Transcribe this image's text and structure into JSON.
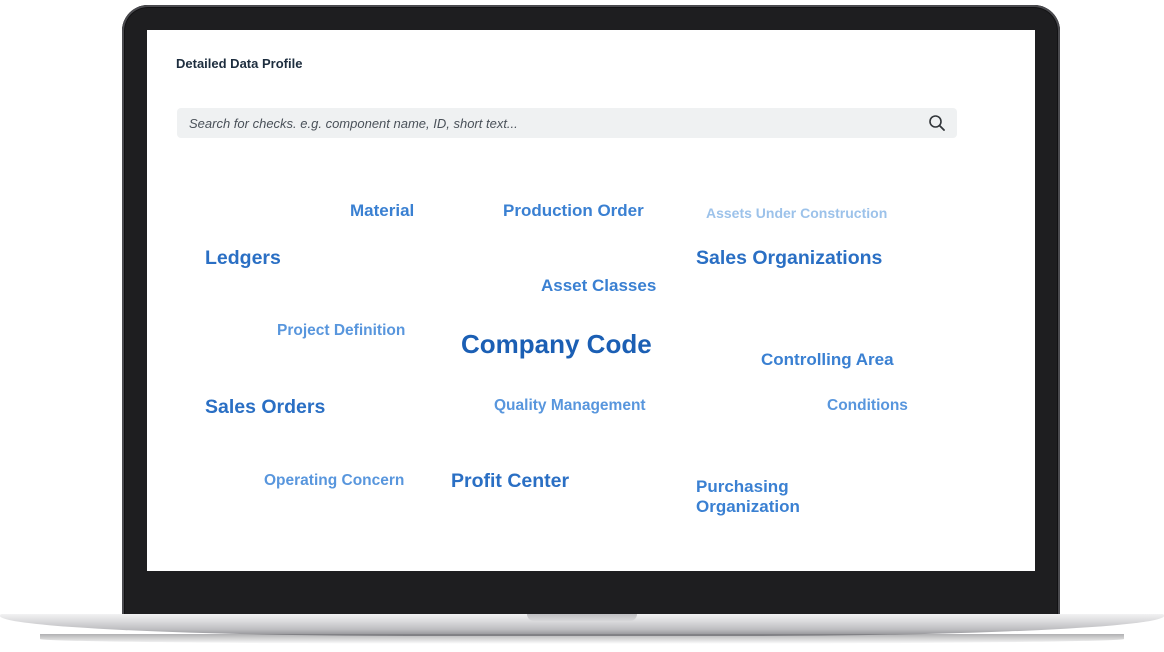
{
  "panel": {
    "title": "Detailed Data Profile"
  },
  "search": {
    "placeholder": "Search for checks. e.g. component name, ID, short text...",
    "value": "",
    "icon": "search-icon"
  },
  "tag_cloud": {
    "tags": [
      {
        "id": "material",
        "label": "Material"
      },
      {
        "id": "production-order",
        "label": "Production Order"
      },
      {
        "id": "assets-under-construction",
        "label": "Assets Under Construction"
      },
      {
        "id": "ledgers",
        "label": "Ledgers"
      },
      {
        "id": "sales-organizations",
        "label": "Sales Organizations"
      },
      {
        "id": "asset-classes",
        "label": "Asset Classes"
      },
      {
        "id": "project-definition",
        "label": "Project Definition"
      },
      {
        "id": "company-code",
        "label": "Company Code"
      },
      {
        "id": "controlling-area",
        "label": "Controlling Area"
      },
      {
        "id": "sales-orders",
        "label": "Sales Orders"
      },
      {
        "id": "quality-management",
        "label": "Quality Management"
      },
      {
        "id": "conditions",
        "label": "Conditions"
      },
      {
        "id": "operating-concern",
        "label": "Operating Concern"
      },
      {
        "id": "profit-center",
        "label": "Profit Center"
      },
      {
        "id": "purchasing-organization-line1",
        "label": "Purchasing"
      },
      {
        "id": "purchasing-organization-line2",
        "label": "Organization"
      }
    ]
  },
  "colors": {
    "bezel": "#1e1e20",
    "title": "#1d2d3e",
    "search_bg": "#eff1f2",
    "tag_lightest": "#9cc2ea",
    "tag_light": "#5896dd",
    "tag_medium": "#3a80d2",
    "tag_strong": "#2a6fc4",
    "tag_strongest": "#1b5fb4"
  }
}
